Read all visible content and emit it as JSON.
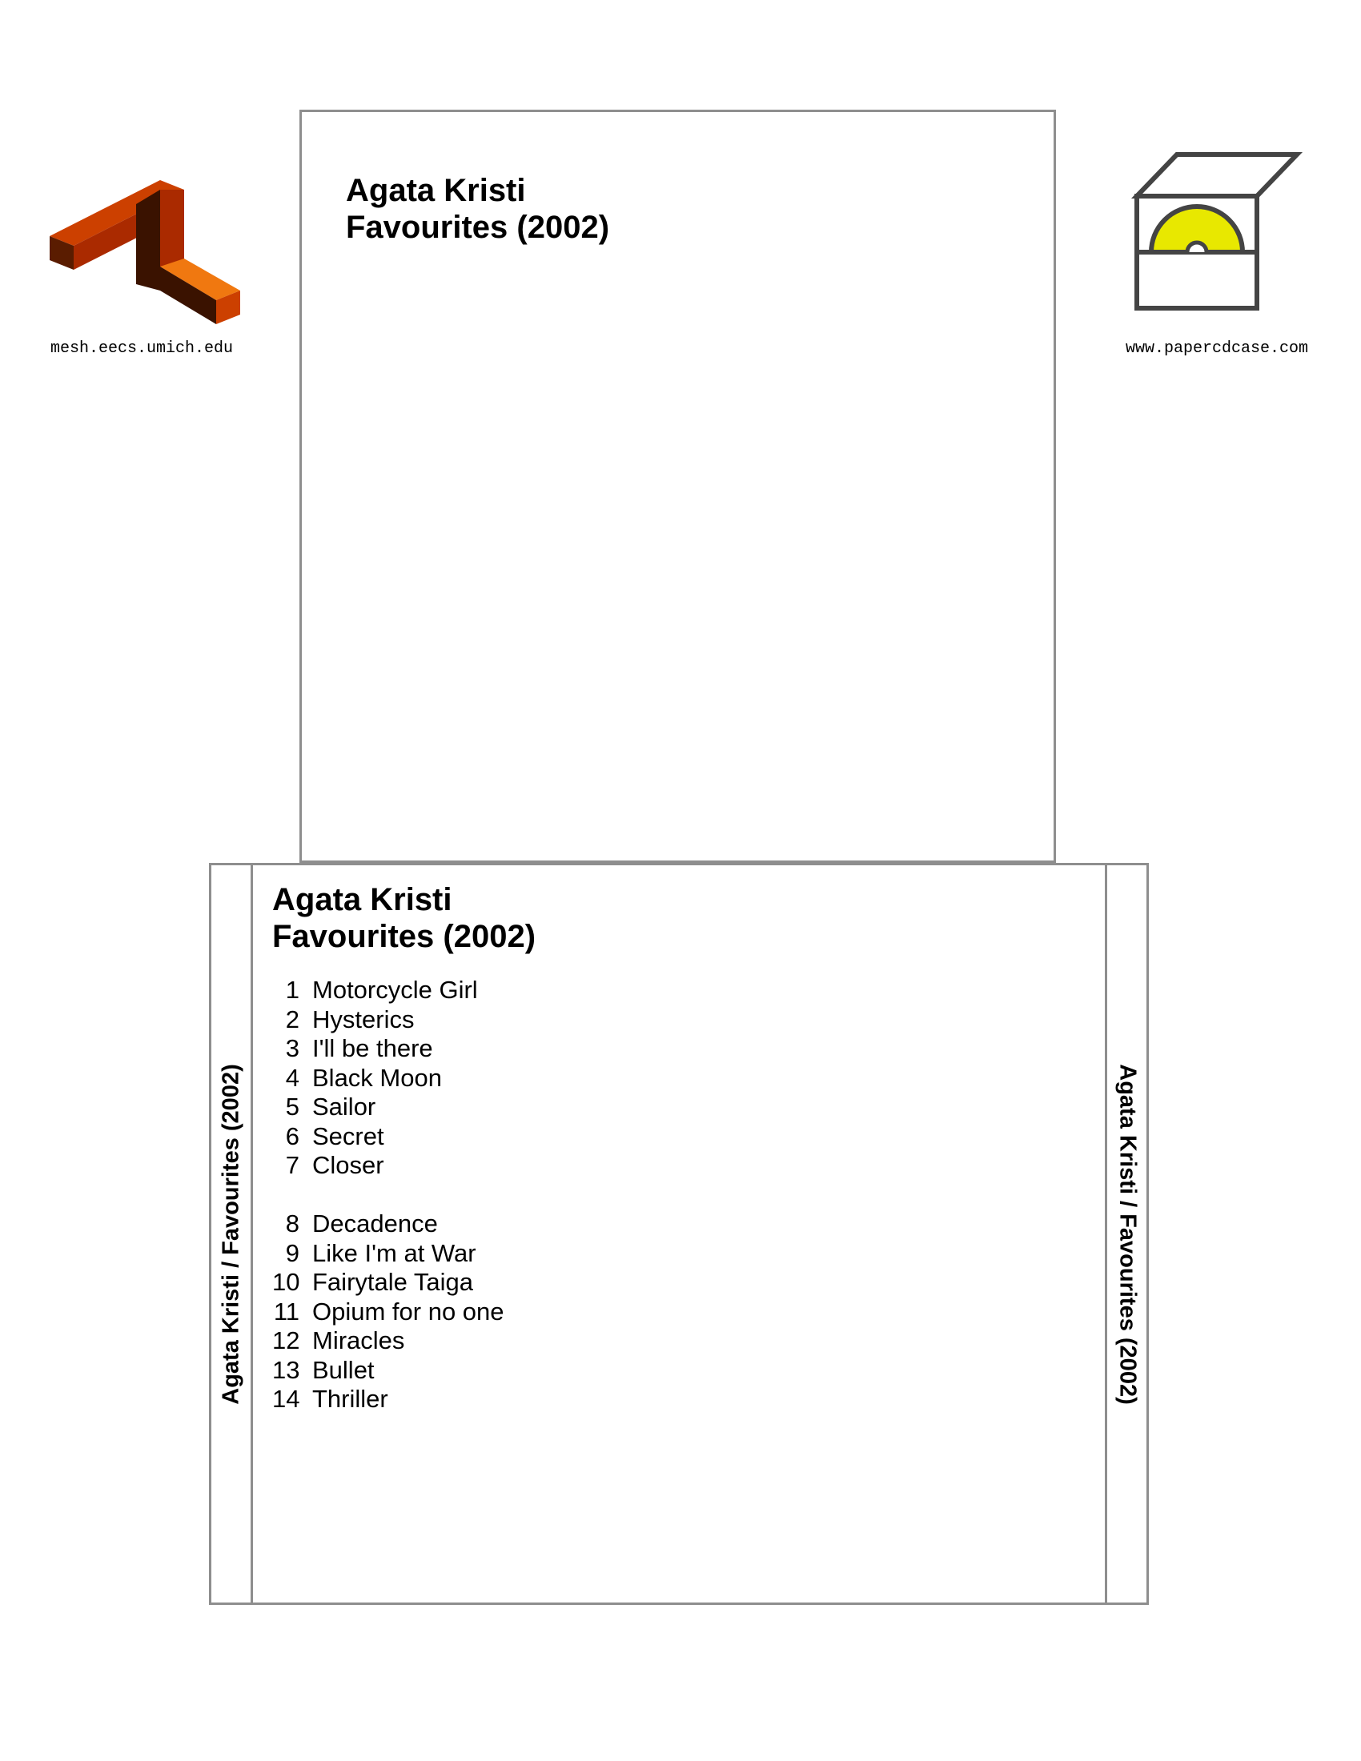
{
  "left_logo": {
    "icon": "mesh-logo-icon",
    "url": "mesh.eecs.umich.edu",
    "colors": {
      "top": "#cc4000",
      "front": "#aa2a00",
      "right": "#f07810",
      "shade": "#3a1200"
    }
  },
  "right_logo": {
    "icon": "paper-cd-case-icon",
    "url": "www.papercdcase.com",
    "colors": {
      "outline": "#444444",
      "disc": "#e8e800"
    }
  },
  "front_cover": {
    "artist": "Agata Kristi",
    "album": "Favourites (2002)"
  },
  "back_cover": {
    "artist": "Agata Kristi",
    "album": "Favourites (2002)",
    "spine_text": "Agata Kristi / Favourites (2002)",
    "tracks_side_a": [
      {
        "num": "1",
        "title": "Motorcycle Girl"
      },
      {
        "num": "2",
        "title": "Hysterics"
      },
      {
        "num": "3",
        "title": "I'll be there"
      },
      {
        "num": "4",
        "title": "Black Moon"
      },
      {
        "num": "5",
        "title": "Sailor"
      },
      {
        "num": "6",
        "title": "Secret"
      },
      {
        "num": "7",
        "title": "Closer"
      }
    ],
    "tracks_side_b": [
      {
        "num": "8",
        "title": "Decadence"
      },
      {
        "num": "9",
        "title": "Like I'm at War"
      },
      {
        "num": "10",
        "title": "Fairytale Taiga"
      },
      {
        "num": "11",
        "title": "Opium for no one"
      },
      {
        "num": "12",
        "title": "Miracles"
      },
      {
        "num": "13",
        "title": "Bullet"
      },
      {
        "num": "14",
        "title": "Thriller"
      }
    ]
  },
  "border_color": "#8e8e8e"
}
